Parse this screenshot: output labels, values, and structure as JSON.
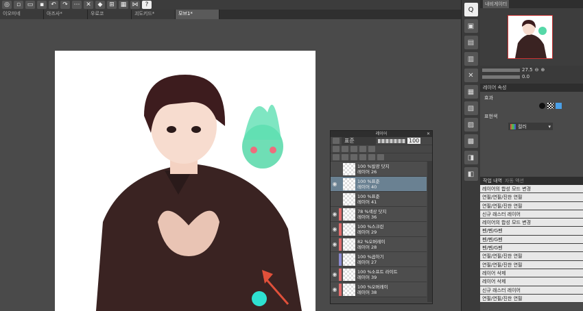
{
  "tabs": [
    "이오미네",
    "아즈사*",
    "우로코",
    "괴도키드*",
    "모브1*"
  ],
  "layer_panel": {
    "title": "레이어",
    "blend_mode": "표준",
    "opacity": "100",
    "layers": [
      {
        "line1": "100 %발광 닷지",
        "line2": "레이어 26",
        "visible": false,
        "clip": "",
        "selected": false
      },
      {
        "line1": "100 %표준",
        "line2": "레이어 40",
        "visible": true,
        "clip": "",
        "selected": true
      },
      {
        "line1": "100 %표준",
        "line2": "레이어 41",
        "visible": false,
        "clip": "",
        "selected": false
      },
      {
        "line1": "78 %색상 닷지",
        "line2": "레이어 36",
        "visible": true,
        "clip": "#e06a6a",
        "selected": false
      },
      {
        "line1": "100 %스크린",
        "line2": "레이어 29",
        "visible": true,
        "clip": "#e06a6a",
        "selected": false
      },
      {
        "line1": "82 %오버레이",
        "line2": "레이어 28",
        "visible": true,
        "clip": "#e06a6a",
        "selected": false
      },
      {
        "line1": "100 %곱하기",
        "line2": "레이어 27",
        "visible": false,
        "clip": "#8a8ad0",
        "selected": false
      },
      {
        "line1": "100 %소프트 라이트",
        "line2": "레이어 39",
        "visible": true,
        "clip": "#e06a6a",
        "selected": false
      },
      {
        "line1": "100 %오버레이",
        "line2": "레이어 38",
        "visible": true,
        "clip": "#e06a6a",
        "selected": false
      }
    ]
  },
  "navigator": {
    "title": "내비게이터",
    "zoom": "27.5",
    "angle": "0.0"
  },
  "properties": {
    "title": "레이어 속성",
    "effect_label": "효과",
    "expression_label": "표현색",
    "expression_value": "컬러"
  },
  "history": {
    "title": "작업 내역",
    "tab2": "자동 액션",
    "items": [
      "레이어의 합성 모드 변경",
      "연필/연필/진한 연필",
      "연필/연필/진한 연필",
      "신규 래스터 레이어",
      "레이어의 합성 모드 변경",
      "펜/펜/G펜",
      "펜/펜/G펜",
      "펜/펜/G펜",
      "연필/연필/진한 연필",
      "연필/연필/진한 연필",
      "레이어 삭제",
      "레이어 삭제",
      "신규 래스터 레이어",
      "연필/연필/진한 연필"
    ]
  },
  "colors": {
    "accent": "#6a8192",
    "panel": "#4a4a4a"
  }
}
